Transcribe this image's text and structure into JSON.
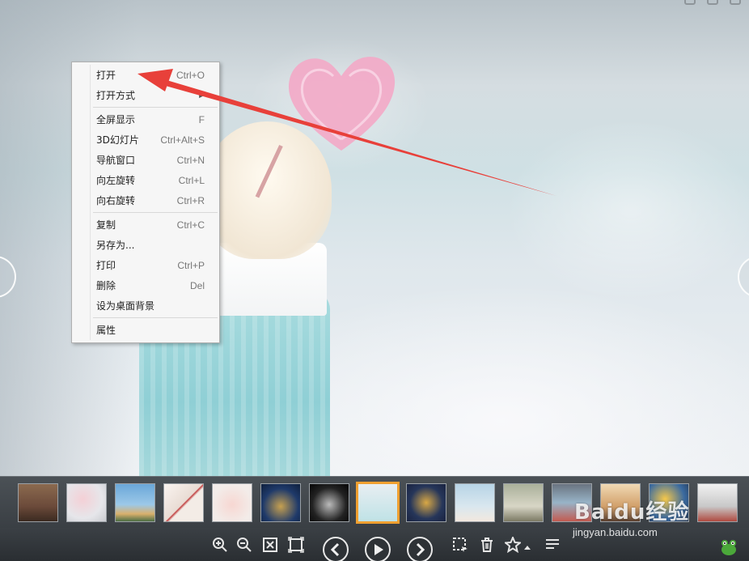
{
  "context_menu": {
    "items": [
      {
        "label": "打开",
        "shortcut": "Ctrl+O"
      },
      {
        "label": "打开方式",
        "shortcut": "",
        "submenu": true
      },
      {
        "label": "全屏显示",
        "shortcut": "F"
      },
      {
        "label": "3D幻灯片",
        "shortcut": "Ctrl+Alt+S"
      },
      {
        "label": "导航窗口",
        "shortcut": "Ctrl+N"
      },
      {
        "label": "向左旋转",
        "shortcut": "Ctrl+L"
      },
      {
        "label": "向右旋转",
        "shortcut": "Ctrl+R"
      },
      {
        "label": "复制",
        "shortcut": "Ctrl+C"
      },
      {
        "label": "另存为...",
        "shortcut": ""
      },
      {
        "label": "打印",
        "shortcut": "Ctrl+P"
      },
      {
        "label": "删除",
        "shortcut": "Del"
      },
      {
        "label": "设为桌面背景",
        "shortcut": ""
      },
      {
        "label": "属性",
        "shortcut": ""
      }
    ]
  },
  "annotation": {
    "color": "#e8403a",
    "points_to": "打开"
  },
  "thumbnail_strip": {
    "count": 15,
    "active_index": 7,
    "active_color": "#f0a030"
  },
  "toolbar": {
    "icons": [
      "zoom-in-icon",
      "zoom-out-icon",
      "fit-screen-icon",
      "actual-size-icon",
      "previous-icon",
      "play-icon",
      "next-icon",
      "crop-icon",
      "delete-icon",
      "favorite-icon",
      "menu-icon"
    ]
  },
  "watermark": {
    "brand": "Baidu经验",
    "url": "jingyan.baidu.com"
  }
}
